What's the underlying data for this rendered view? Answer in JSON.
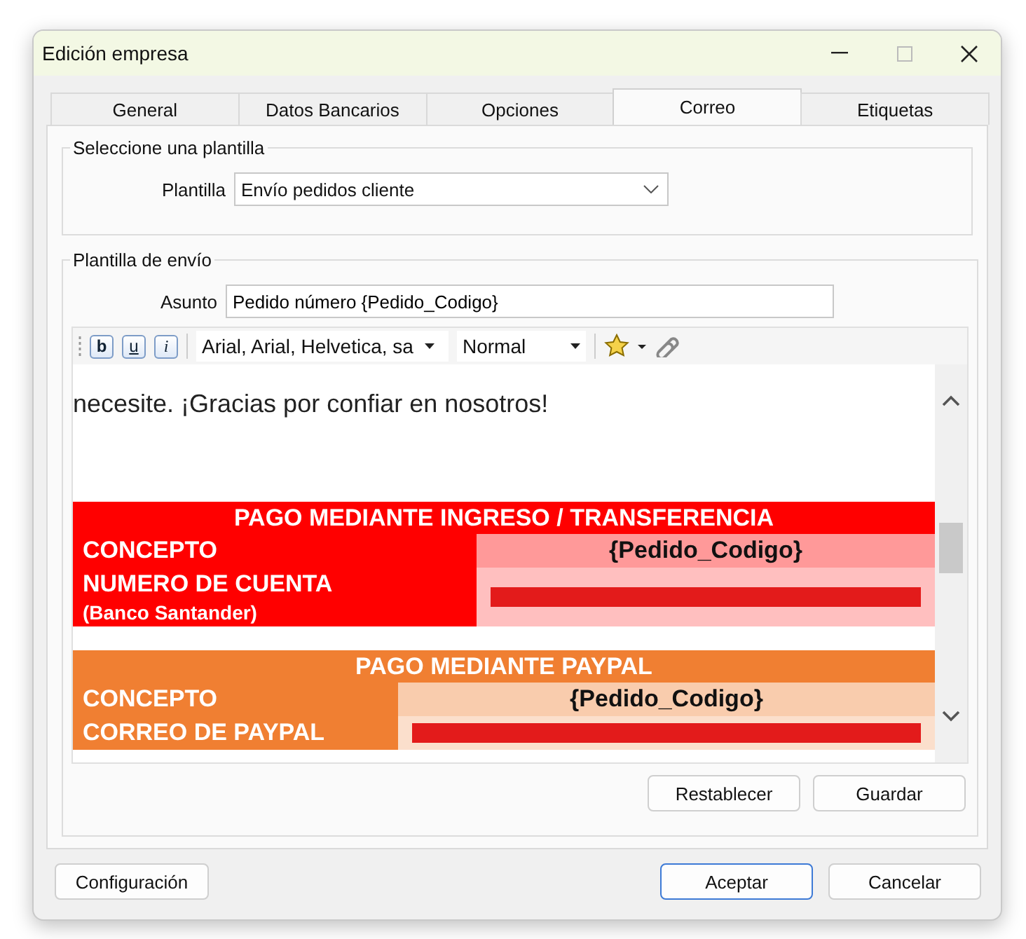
{
  "window": {
    "title": "Edición empresa"
  },
  "tabs": [
    {
      "label": "General",
      "selected": false
    },
    {
      "label": "Datos Bancarios",
      "selected": false
    },
    {
      "label": "Opciones",
      "selected": false
    },
    {
      "label": "Correo",
      "selected": true
    },
    {
      "label": "Etiquetas",
      "selected": false
    }
  ],
  "template_group": {
    "legend": "Seleccione una plantilla",
    "label": "Plantilla",
    "value": "Envío pedidos cliente"
  },
  "send_group": {
    "legend": "Plantilla de envío",
    "subject_label": "Asunto",
    "subject_value": "Pedido número {Pedido_Codigo}",
    "toolbar": {
      "format_buttons": [
        "b",
        "u",
        "i"
      ],
      "font": "Arial, Arial, Helvetica, sa",
      "size": "Normal"
    },
    "body": {
      "paragraph": "necesite. ¡Gracias por confiar en nosotros!",
      "tables": [
        {
          "title": "PAGO MEDIANTE INGRESO / TRANSFERENCIA",
          "color": "#ff0000",
          "rows": [
            {
              "label": "CONCEPTO",
              "value": "{Pedido_Codigo}",
              "redacted": false
            },
            {
              "label": "NUMERO DE CUENTA",
              "note": "(Banco Santander)",
              "redacted": true
            }
          ]
        },
        {
          "title": "PAGO MEDIANTE PAYPAL",
          "color": "#f07f32",
          "rows": [
            {
              "label": "CONCEPTO",
              "value": "{Pedido_Codigo}",
              "redacted": false
            },
            {
              "label": "CORREO DE PAYPAL",
              "redacted": true
            }
          ]
        }
      ]
    },
    "buttons": [
      "Restablecer",
      "Guardar"
    ]
  },
  "footer": {
    "left_button": "Configuración",
    "buttons": [
      {
        "label": "Aceptar",
        "default": true
      },
      {
        "label": "Cancelar",
        "default": false
      }
    ]
  }
}
